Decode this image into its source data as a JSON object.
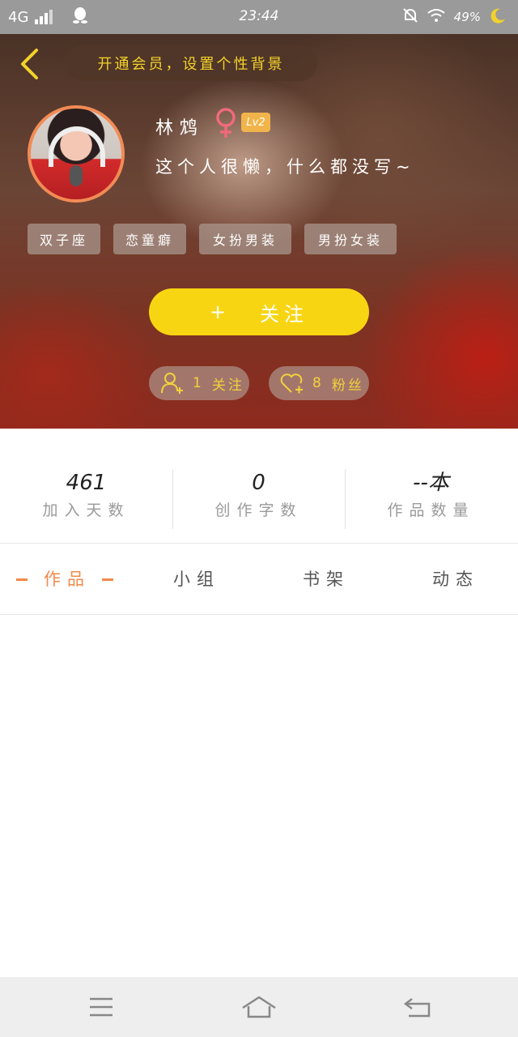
{
  "status_bar": {
    "network": "4G",
    "time": "23:44",
    "battery": "49%"
  },
  "header": {
    "banner_text": "开通会员，设置个性背景",
    "user_name": "林鸩",
    "level": "Lv2",
    "bio": "这个人很懒，什么都没写~",
    "tags": [
      "双子座",
      "恋童癖",
      "女扮男装",
      "男扮女装"
    ],
    "follow_button": {
      "icon": "+",
      "label": "关注"
    },
    "following": {
      "count": "1",
      "label": "关注"
    },
    "fans": {
      "count": "8",
      "label": "粉丝"
    }
  },
  "stats": [
    {
      "value": "461",
      "label": "加入天数"
    },
    {
      "value": "0",
      "label": "创作字数"
    },
    {
      "value": "--本",
      "label": "作品数量"
    }
  ],
  "tabs": [
    "作品",
    "小组",
    "书架",
    "动态"
  ],
  "colors": {
    "accent": "#f28a4a",
    "follow_button": "#f8d512",
    "banner_text": "#f3d22b",
    "level_badge": "#f1b44a",
    "gender_icon": "#f06a7a"
  },
  "icons": {
    "back": "back-arrow-icon",
    "female": "female-icon",
    "following": "add-user-icon",
    "fans": "heart-plus-icon",
    "nav_menu": "menu-icon",
    "nav_home": "home-icon",
    "nav_back": "return-icon"
  }
}
